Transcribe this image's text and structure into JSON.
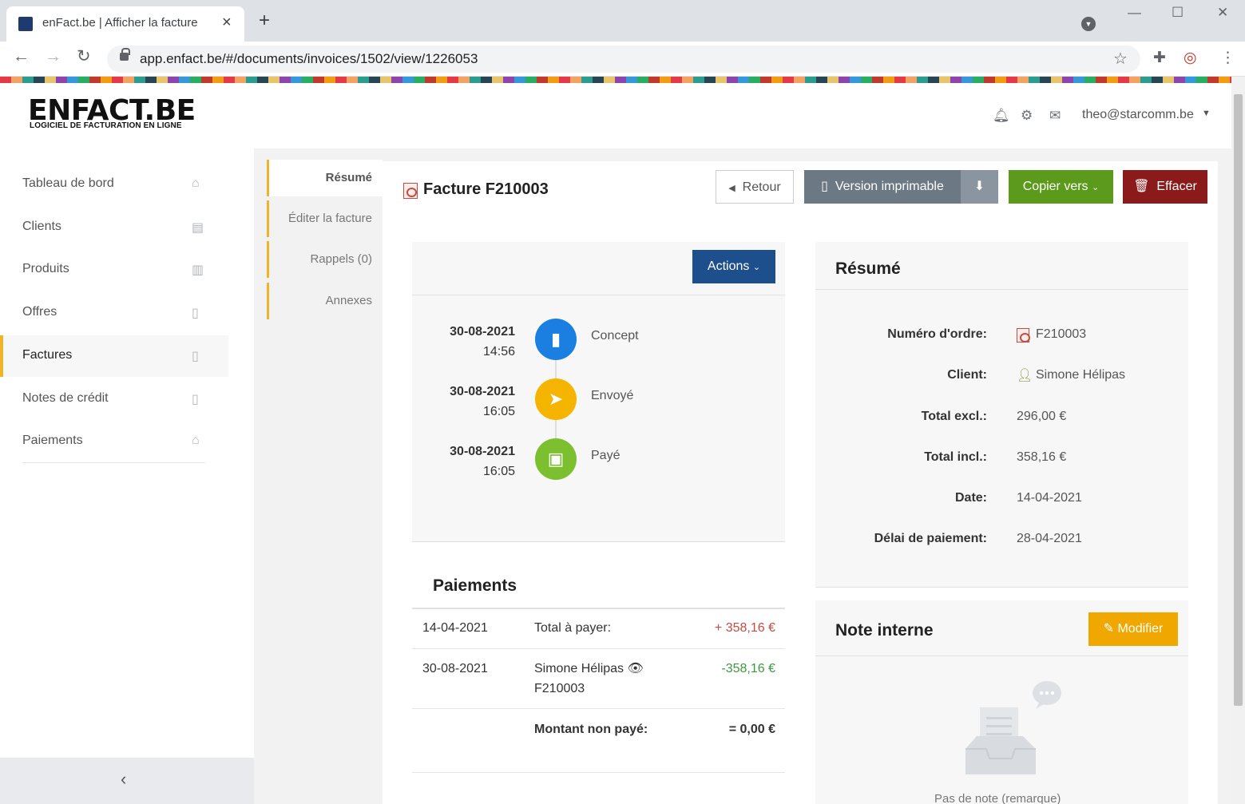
{
  "browser": {
    "tab_title": "enFact.be | Afficher la facture",
    "url": "app.enfact.be/#/documents/invoices/1502/view/1226053"
  },
  "header": {
    "logo": "ENFACT.BE",
    "logo_tagline": "LOGICIEL DE FACTURATION EN LIGNE",
    "user_email": "theo@starcomm.be"
  },
  "sidebar": {
    "items": [
      {
        "label": "Tableau de bord",
        "icon": "home-icon"
      },
      {
        "label": "Clients",
        "icon": "address-book-icon"
      },
      {
        "label": "Produits",
        "icon": "barcode-icon"
      },
      {
        "label": "Offres",
        "icon": "pdf-file-icon"
      },
      {
        "label": "Factures",
        "icon": "pdf-file-icon",
        "active": true
      },
      {
        "label": "Notes de crédit",
        "icon": "pdf-file-icon"
      },
      {
        "label": "Paiements",
        "icon": "bank-icon"
      }
    ]
  },
  "subnav": {
    "items": [
      "Résumé",
      "Éditer la facture",
      "Rappels (0)",
      "Annexes"
    ]
  },
  "invoice": {
    "title": "Facture F210003",
    "buttons": {
      "retour": "Retour",
      "print": "Version imprimable",
      "copy": "Copier vers",
      "delete": "Effacer",
      "actions": "Actions"
    }
  },
  "timeline": [
    {
      "date": "30-08-2021",
      "time": "14:56",
      "label": "Concept",
      "color": "#1a7fe0"
    },
    {
      "date": "30-08-2021",
      "time": "16:05",
      "label": "Envoyé",
      "color": "#f5b400"
    },
    {
      "date": "30-08-2021",
      "time": "16:05",
      "label": "Payé",
      "color": "#7cbf2f"
    }
  ],
  "payments": {
    "title": "Paiements",
    "rows": [
      {
        "date": "14-04-2021",
        "desc": "Total à payer:",
        "desc2": "",
        "amount": "+ 358,16 €"
      },
      {
        "date": "30-08-2021",
        "desc": "Simone Hélipas",
        "desc2": "F210003",
        "amount": "-358,16 €"
      }
    ],
    "unpaid_label": "Montant non payé:",
    "unpaid_value": "= 0,00 €"
  },
  "summary": {
    "title": "Résumé",
    "fields": [
      {
        "key": "Numéro d'ordre:",
        "value": "F210003"
      },
      {
        "key": "Client:",
        "value": "Simone Hélipas"
      },
      {
        "key": "Total excl.:",
        "value": "296,00 €"
      },
      {
        "key": "Total incl.:",
        "value": "358,16 €"
      },
      {
        "key": "Date:",
        "value": "14-04-2021"
      },
      {
        "key": "Délai de paiement:",
        "value": "28-04-2021"
      }
    ]
  },
  "note": {
    "title": "Note interne",
    "modify": "Modifier",
    "empty": "Pas de note (remarque)"
  },
  "colors": {
    "accent": "#f0b429",
    "actions_blue": "#1d4f8c",
    "copy_green": "#5b9a1a",
    "delete_red": "#8b1a1a",
    "modify_orange": "#f0a800"
  }
}
